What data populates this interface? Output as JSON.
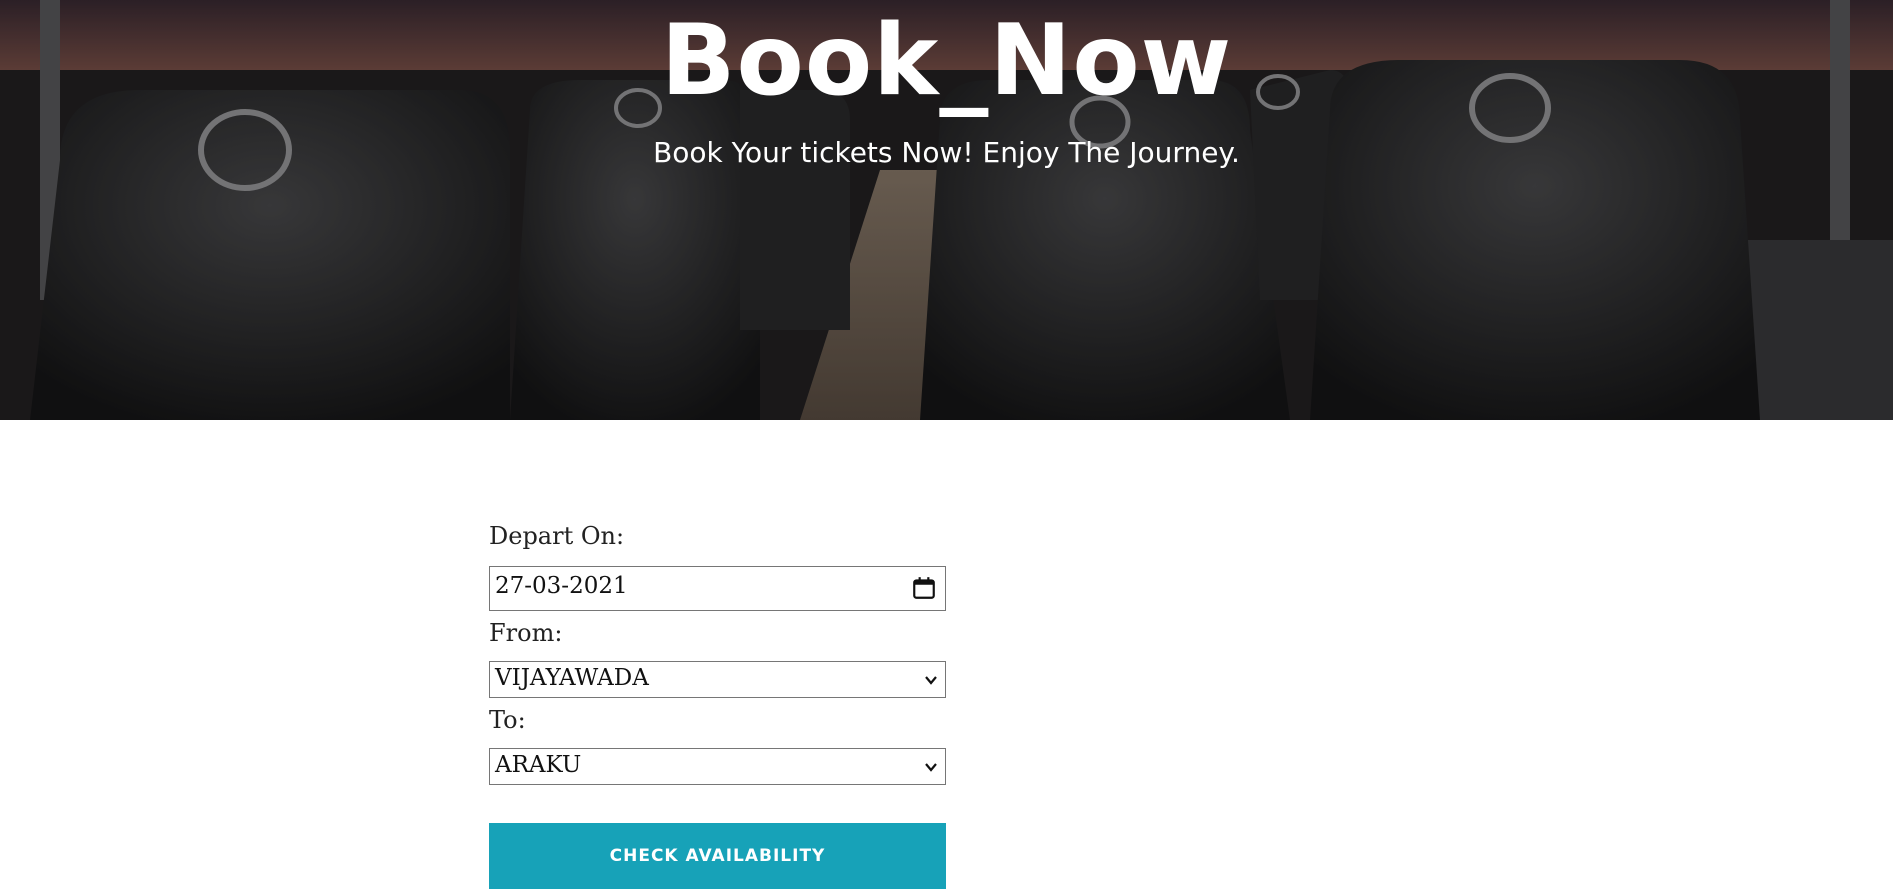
{
  "hero": {
    "title": "Book_Now",
    "subtitle": "Book Your tickets Now! Enjoy The Journey."
  },
  "form": {
    "depart_label": "Depart On:",
    "depart_value": "27-03-2021",
    "from_label": "From:",
    "from_value": "VIJAYAWADA",
    "to_label": "To:",
    "to_value": "ARAKU",
    "submit_label": "CHECK AVAILABILITY"
  },
  "icons": {
    "date": "calendar-icon",
    "select": "chevron-down-icon"
  },
  "colors": {
    "button": "#17a2b8",
    "hero_overlay": "#1e1c1d"
  }
}
